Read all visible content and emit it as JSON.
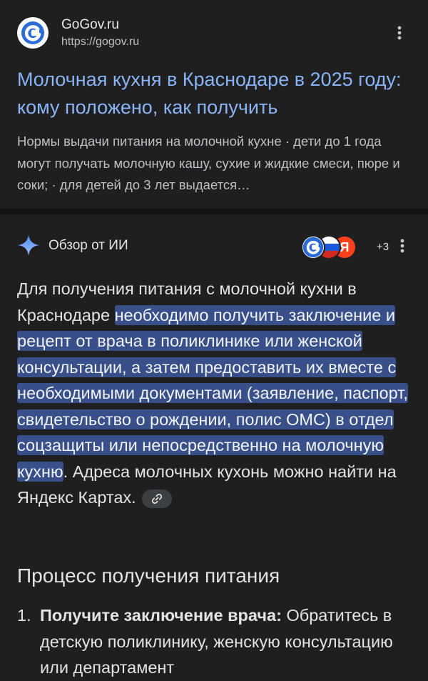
{
  "result": {
    "site_name": "GoGov.ru",
    "site_url": "https://gogov.ru",
    "title": "Молочная кухня в Краснодаре в 2025 году: кому положено, как получить",
    "snippet": "Нормы выдачи питания на молочной кухне · дети до 1 года могут получать молочную кашу, сухие и жидкие смеси, пюре и соки; · для детей до 3 лет выдается…"
  },
  "overview": {
    "title": "Обзор от ИИ",
    "source_count": "+3",
    "answer_lead": "Для получения питания с молочной кухни в Краснодаре ",
    "answer_highlight": "необходимо получить заключение и рецепт от врача в поликлинике или женской консультации, а затем предоставить их вместе с необходимыми документами (заявление, паспорт, свидетельство о рождении, полис ОМС) в отдел соцзащиты или непосредственно на молочную кухню",
    "answer_tail": ". Адреса молочных кухонь можно найти на Яндекс Картах.",
    "section_heading": "Процесс получения питания",
    "steps": [
      {
        "number": "1.",
        "bold": "Получите заключение врача:",
        "text": " Обратитесь в детскую поликлинику, женскую консультацию или департамент"
      }
    ]
  },
  "icons": {
    "favicon": "gogov-logo-icon",
    "sparkle": "gemini-sparkle-icon",
    "link": "link-icon",
    "more": "more-vertical-icon"
  },
  "colors": {
    "background": "#1f1f1f",
    "title_link": "#8ab4f8",
    "highlight": "#394f8a",
    "sparkle_top": "#4f8df7",
    "sparkle_bottom": "#9fc0ff"
  }
}
